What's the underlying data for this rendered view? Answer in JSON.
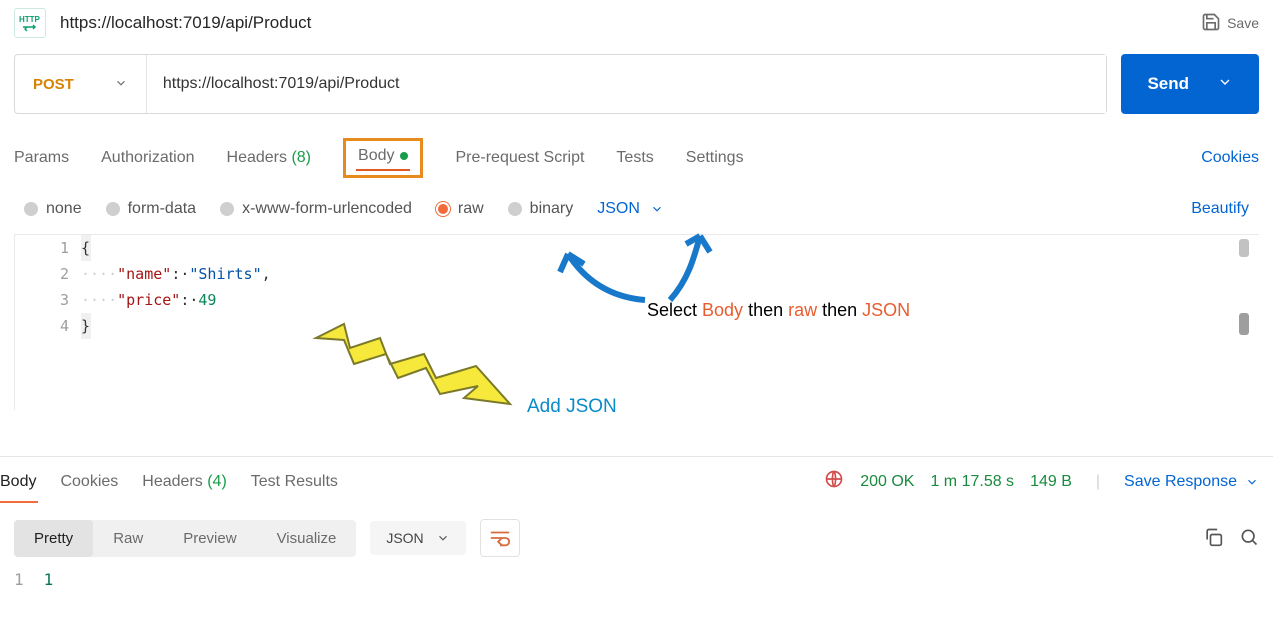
{
  "header": {
    "tab_title": "https://localhost:7019/api/Product",
    "save_label": "Save"
  },
  "request": {
    "method": "POST",
    "url": "https://localhost:7019/api/Product",
    "send_label": "Send"
  },
  "req_tabs": {
    "params": "Params",
    "auth": "Authorization",
    "headers": "Headers",
    "headers_count": "(8)",
    "body": "Body",
    "prerequest": "Pre-request Script",
    "tests": "Tests",
    "settings": "Settings",
    "cookies": "Cookies"
  },
  "body_types": {
    "none": "none",
    "formdata": "form-data",
    "xwww": "x-www-form-urlencoded",
    "raw": "raw",
    "binary": "binary",
    "lang": "JSON",
    "beautify": "Beautify"
  },
  "editor": {
    "l1_gutter": "1",
    "l1_code": "{",
    "l2_gutter": "2",
    "l2_ws": "····",
    "l2_key": "\"name\"",
    "l2_colon": ":·",
    "l2_val": "\"Shirts\"",
    "l2_comma": ",",
    "l3_gutter": "3",
    "l3_ws": "····",
    "l3_key": "\"price\"",
    "l3_colon": ":·",
    "l3_val": "49",
    "l4_gutter": "4",
    "l4_code": "}"
  },
  "annotations": {
    "select_prefix": "Select ",
    "select_body": "Body",
    "select_then1": " then ",
    "select_raw": "raw",
    "select_then2": " then ",
    "select_json": "JSON",
    "add_json": "Add JSON"
  },
  "response": {
    "tabs": {
      "body": "Body",
      "cookies": "Cookies",
      "headers": "Headers",
      "headers_count": "(4)",
      "tests": "Test Results"
    },
    "status": "200 OK",
    "time": "1 m 17.58 s",
    "size": "149 B",
    "save_response": "Save Response",
    "view_tabs": {
      "pretty": "Pretty",
      "raw": "Raw",
      "preview": "Preview",
      "visualize": "Visualize"
    },
    "lang": "JSON",
    "body_gutter": "1",
    "body_value": "1"
  }
}
